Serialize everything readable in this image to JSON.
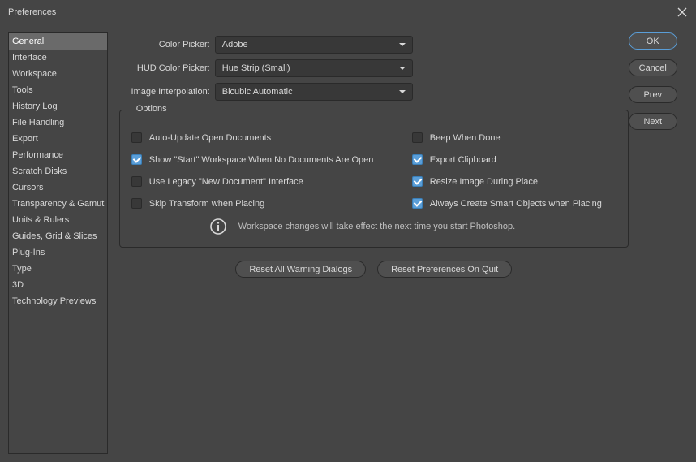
{
  "window": {
    "title": "Preferences"
  },
  "sidebar": {
    "items": [
      "General",
      "Interface",
      "Workspace",
      "Tools",
      "History Log",
      "File Handling",
      "Export",
      "Performance",
      "Scratch Disks",
      "Cursors",
      "Transparency & Gamut",
      "Units & Rulers",
      "Guides, Grid & Slices",
      "Plug-Ins",
      "Type",
      "3D",
      "Technology Previews"
    ]
  },
  "form": {
    "color_picker": {
      "label": "Color Picker:",
      "value": "Adobe"
    },
    "hud": {
      "label": "HUD Color Picker:",
      "value": "Hue Strip (Small)"
    },
    "interp": {
      "label": "Image Interpolation:",
      "value": "Bicubic Automatic"
    }
  },
  "options": {
    "legend": "Options",
    "left": [
      {
        "label": "Auto-Update Open Documents",
        "checked": false
      },
      {
        "label": "Show \"Start\" Workspace When No Documents Are Open",
        "checked": true
      },
      {
        "label": "Use Legacy \"New Document\" Interface",
        "checked": false
      },
      {
        "label": "Skip Transform when Placing",
        "checked": false
      }
    ],
    "right": [
      {
        "label": "Beep When Done",
        "checked": false
      },
      {
        "label": "Export Clipboard",
        "checked": true
      },
      {
        "label": "Resize Image During Place",
        "checked": true
      },
      {
        "label": "Always Create Smart Objects when Placing",
        "checked": true
      }
    ],
    "info": "Workspace changes will take effect the next time you start Photoshop."
  },
  "buttons": {
    "reset_warnings": "Reset All Warning Dialogs",
    "reset_prefs": "Reset Preferences On Quit",
    "ok": "OK",
    "cancel": "Cancel",
    "prev": "Prev",
    "next": "Next"
  }
}
